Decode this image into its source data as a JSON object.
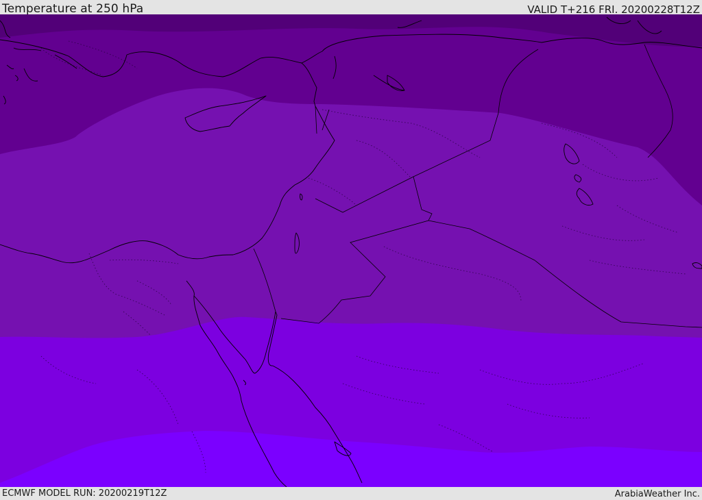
{
  "header": {
    "title": "Temperature at 250 hPa",
    "valid": "VALID T+216 FRI. 20200228T12Z"
  },
  "footer": {
    "model_run": "ECMWF MODEL RUN: 20200219T12Z",
    "credit": "ArabiaWeather Inc."
  },
  "colors": {
    "band_darkest": "#520078",
    "band_dark": "#620090",
    "band_mid": "#7511b0",
    "band_violet": "#7c00e0",
    "band_bright": "#7b00ff",
    "bar_background": "#e4e4e4"
  }
}
